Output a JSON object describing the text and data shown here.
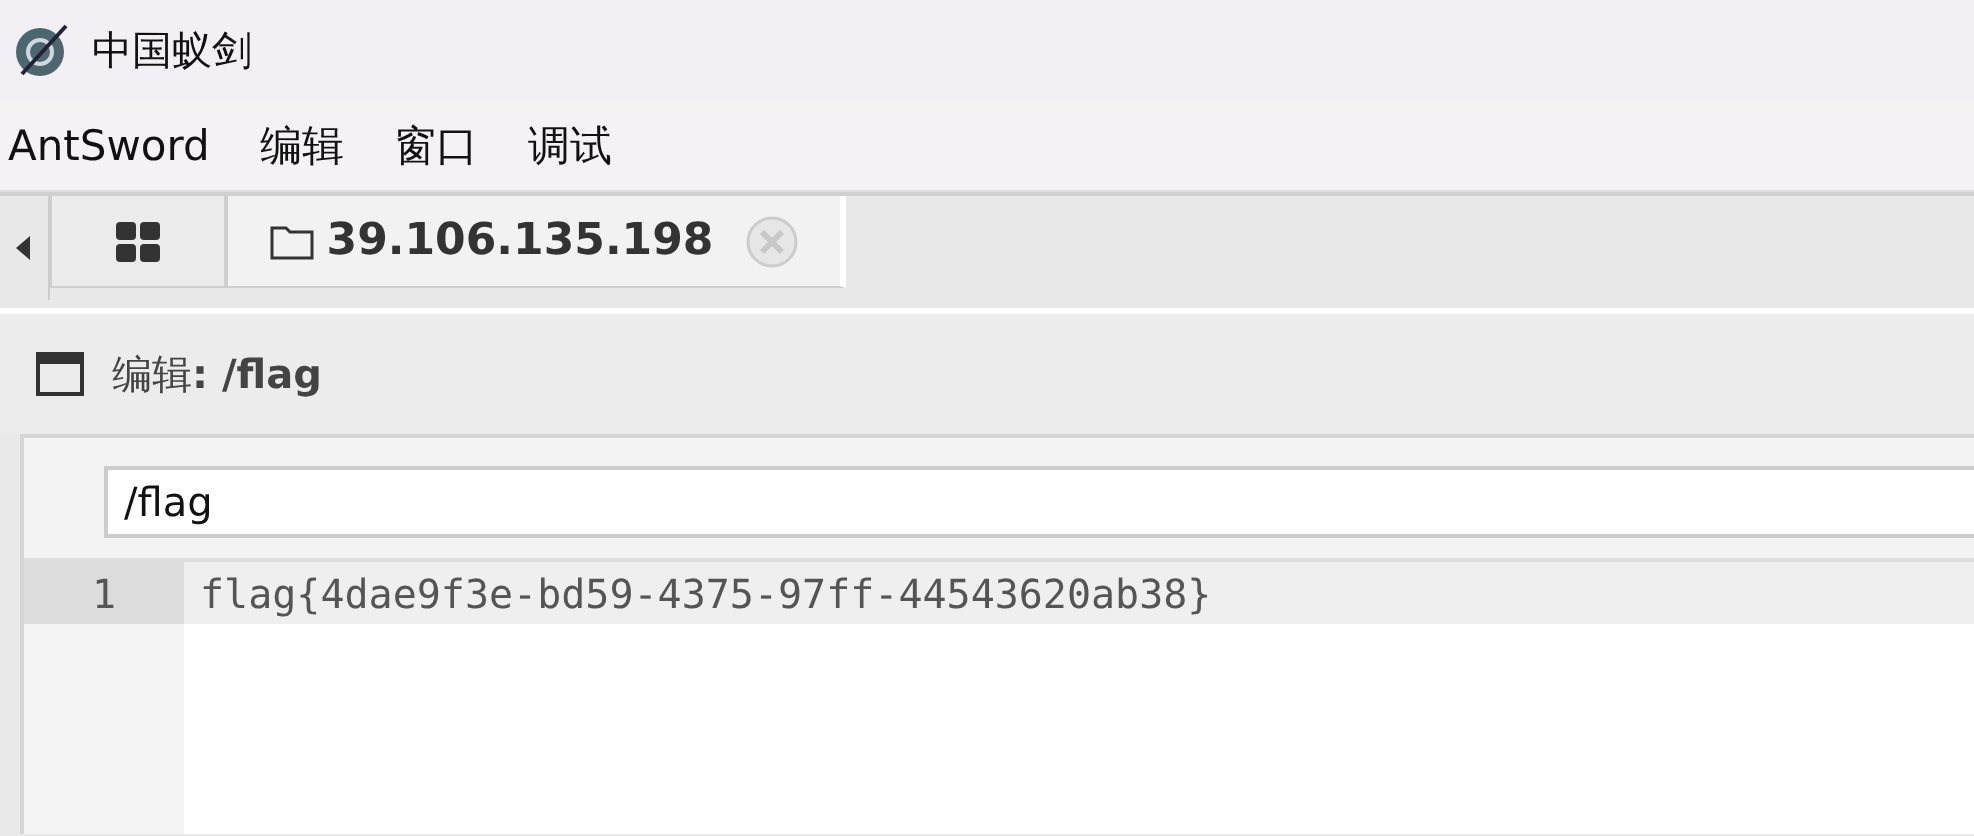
{
  "window": {
    "title": "中国蚁剑"
  },
  "menu": [
    "AntSword",
    "编辑",
    "窗口",
    "调试"
  ],
  "tabs": [
    {
      "kind": "grid",
      "selected": false
    },
    {
      "kind": "folder",
      "label": "39.106.135.198",
      "selected": true,
      "closable": true
    }
  ],
  "panel": {
    "title": "编辑**: /flag**"
  },
  "editor": {
    "path": "/flag",
    "lines": [
      {
        "number": "1",
        "text": "flag{4dae9f3e-bd59-4375-97ff-44543620ab38}",
        "current": true
      }
    ]
  }
}
